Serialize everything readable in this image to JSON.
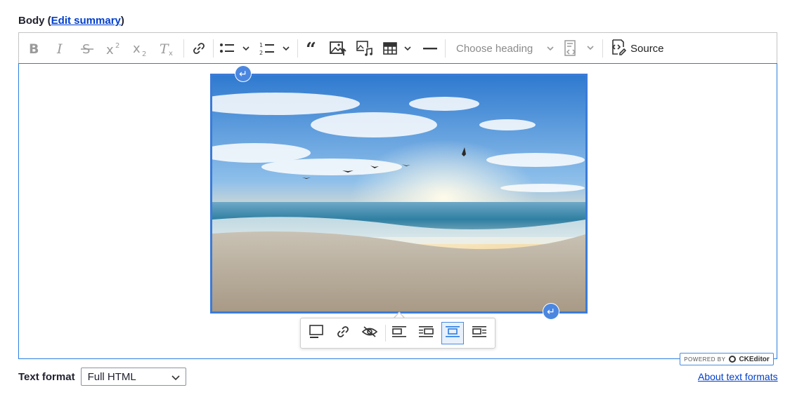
{
  "field": {
    "label": "Body",
    "open_paren": "(",
    "edit_summary": "Edit summary",
    "close_paren": ")"
  },
  "toolbar": {
    "buttons": [
      "bold",
      "italic",
      "strikethrough",
      "superscript",
      "subscript",
      "remove-format",
      "link",
      "bulleted-list",
      "numbered-list",
      "blockquote",
      "insert-image",
      "insert-media",
      "insert-table",
      "horizontal-line",
      "code-block",
      "source"
    ],
    "heading_placeholder": "Choose heading",
    "source_label": "Source"
  },
  "image_toolbar": {
    "buttons": [
      "toggle-caption",
      "link-image",
      "hide-alt-text",
      "align-left",
      "align-right",
      "align-center",
      "wrap-text"
    ],
    "active": "align-center"
  },
  "powered_by": {
    "prefix": "POWERED BY",
    "brand": "CKEditor"
  },
  "text_format": {
    "label": "Text format",
    "selected": "Full HTML",
    "about_link": "About text formats"
  },
  "colors": {
    "accent": "#2b7de1",
    "link": "#003ecc"
  }
}
